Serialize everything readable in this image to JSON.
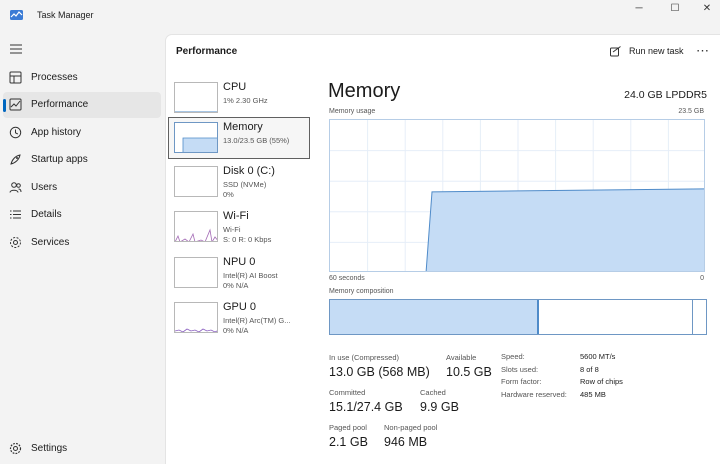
{
  "window": {
    "title": "Task Manager",
    "minimize_glyph": "─",
    "maximize_glyph": "☐",
    "close_glyph": "✕"
  },
  "nav": {
    "items": [
      {
        "label": "Processes",
        "icon": "processes-icon"
      },
      {
        "label": "Performance",
        "icon": "performance-icon",
        "selected": true
      },
      {
        "label": "App history",
        "icon": "app-history-icon"
      },
      {
        "label": "Startup apps",
        "icon": "startup-apps-icon"
      },
      {
        "label": "Users",
        "icon": "users-icon"
      },
      {
        "label": "Details",
        "icon": "details-icon"
      },
      {
        "label": "Services",
        "icon": "services-icon"
      }
    ],
    "settings_label": "Settings"
  },
  "header": {
    "page_title": "Performance",
    "run_new_task_label": "Run new task",
    "more_glyph": "⋯"
  },
  "devices": [
    {
      "name": "CPU",
      "line1": "1% 2.30 GHz",
      "line2": ""
    },
    {
      "name": "Memory",
      "line1": "13.0/23.5 GB (55%)",
      "line2": "",
      "selected": true
    },
    {
      "name": "Disk 0 (C:)",
      "line1": "SSD (NVMe)",
      "line2": "0%"
    },
    {
      "name": "Wi-Fi",
      "line1": "Wi-Fi",
      "line2": "S: 0 R: 0 Kbps"
    },
    {
      "name": "NPU 0",
      "line1": "Intel(R) AI Boost",
      "line2": "0% N/A"
    },
    {
      "name": "GPU 0",
      "line1": "Intel(R) Arc(TM) G...",
      "line2": "0% N/A"
    }
  ],
  "detail": {
    "title": "Memory",
    "spec": "24.0 GB LPDDR5",
    "usage_label": "Memory usage",
    "usage_max": "23.5 GB",
    "time_left": "60 seconds",
    "time_right": "0",
    "composition_label": "Memory composition",
    "usage_fraction": 0.55,
    "composition": {
      "in_use_fraction": 0.555,
      "standby_end_fraction": 0.965
    },
    "colors": {
      "fill": "#c5dcf5",
      "line": "#4f8bc9"
    },
    "stats": {
      "in_use_label": "In use (Compressed)",
      "in_use_value": "13.0 GB (568 MB)",
      "available_label": "Available",
      "available_value": "10.5 GB",
      "committed_label": "Committed",
      "committed_value": "15.1/27.4 GB",
      "cached_label": "Cached",
      "cached_value": "9.9 GB",
      "paged_label": "Paged pool",
      "paged_value": "2.1 GB",
      "nonpaged_label": "Non-paged pool",
      "nonpaged_value": "946 MB"
    },
    "props": [
      {
        "label": "Speed:",
        "value": "5600 MT/s"
      },
      {
        "label": "Slots used:",
        "value": "8 of 8"
      },
      {
        "label": "Form factor:",
        "value": "Row of chips"
      },
      {
        "label": "Hardware reserved:",
        "value": "485 MB"
      }
    ]
  }
}
